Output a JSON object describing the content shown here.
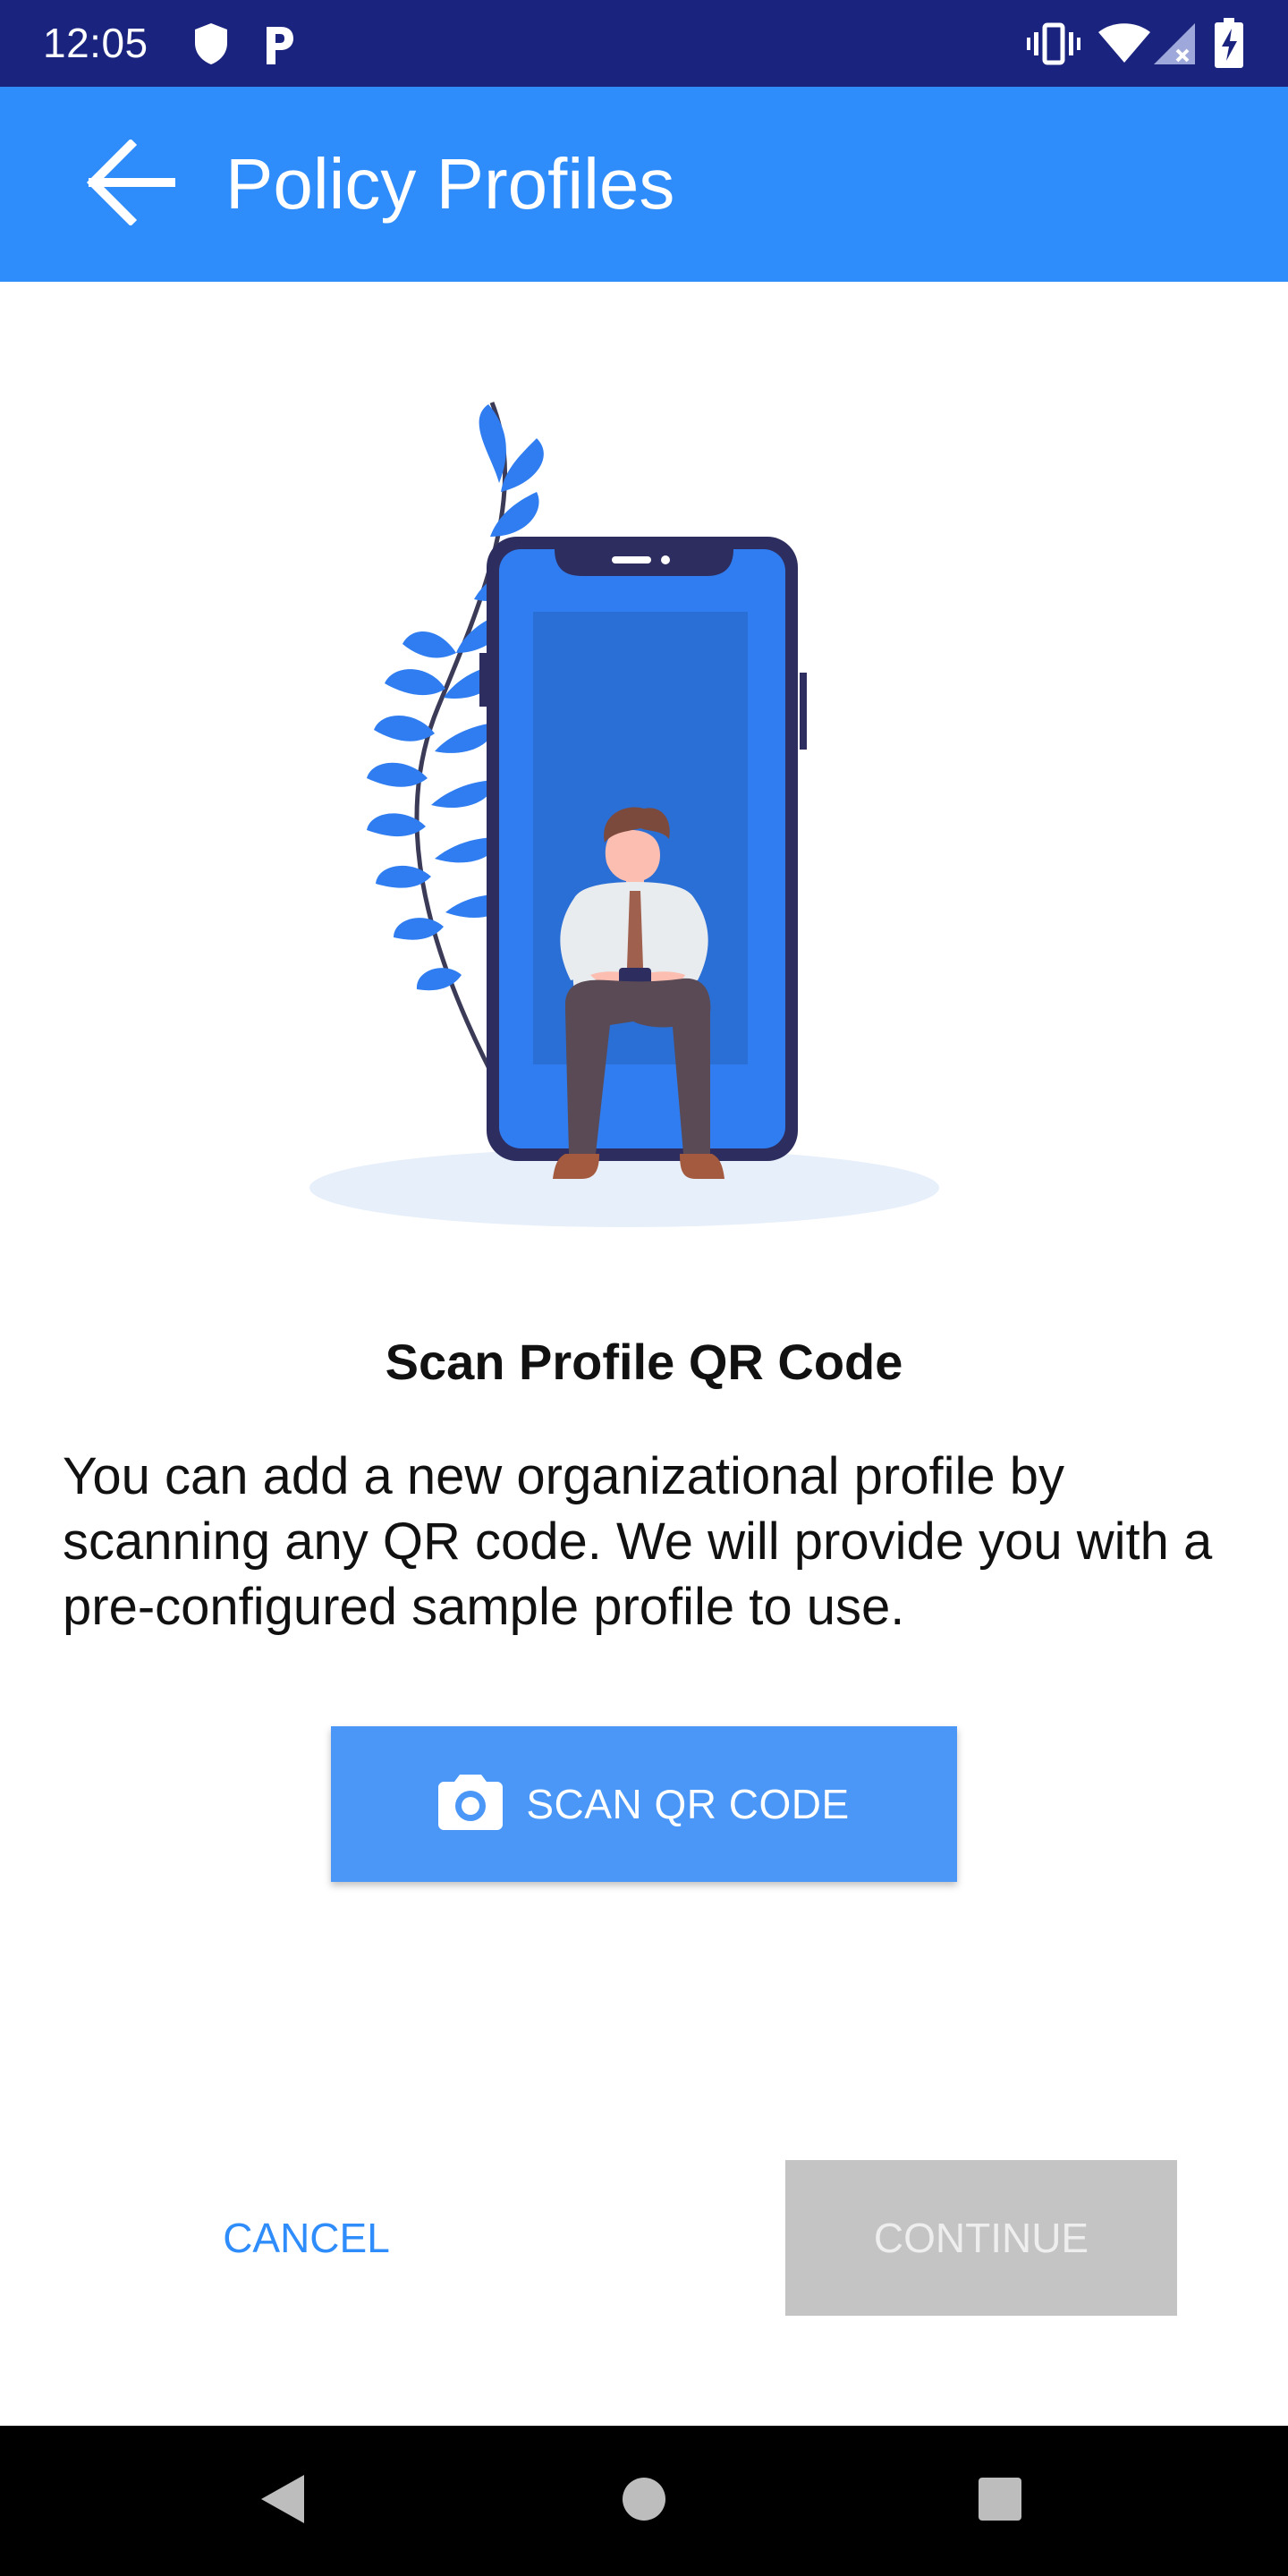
{
  "status_bar": {
    "time": "12:05",
    "icons": [
      "shield-icon",
      "p-app-icon",
      "vibrate-icon",
      "wifi-icon",
      "no-signal-icon",
      "battery-charging-icon"
    ]
  },
  "app_bar": {
    "title": "Policy Profiles",
    "back_icon": "arrow-left-icon",
    "background_color": "#2f8cfb"
  },
  "content": {
    "headline": "Scan Profile QR Code",
    "body": "You can add a new organizational profile by scanning any QR code. We will provide you with a pre-configured sample profile to use.",
    "scan_button": {
      "label": "SCAN QR CODE",
      "icon": "camera-icon",
      "color": "#4a97f8"
    }
  },
  "actions": {
    "cancel_label": "CANCEL",
    "continue_label": "CONTINUE",
    "continue_enabled": false
  },
  "nav_bar": {
    "icons": [
      "back-triangle-icon",
      "home-circle-icon",
      "recents-square-icon"
    ]
  }
}
